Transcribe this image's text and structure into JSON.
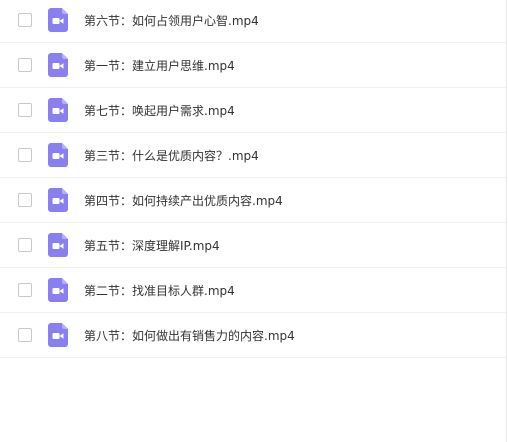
{
  "colors": {
    "icon_bg": "#8a7ff0",
    "icon_fold": "#b6aefa",
    "icon_glyph": "#ffffff",
    "text": "#333333"
  },
  "files": [
    {
      "name": "第六节：如何占领用户心智.mp4",
      "icon": "video-file-icon"
    },
    {
      "name": "第一节：建立用户思维.mp4",
      "icon": "video-file-icon"
    },
    {
      "name": "第七节：唤起用户需求.mp4",
      "icon": "video-file-icon"
    },
    {
      "name": "第三节：什么是优质内容？.mp4",
      "icon": "video-file-icon"
    },
    {
      "name": "第四节：如何持续产出优质内容.mp4",
      "icon": "video-file-icon"
    },
    {
      "name": "第五节：深度理解IP.mp4",
      "icon": "video-file-icon"
    },
    {
      "name": "第二节：找准目标人群.mp4",
      "icon": "video-file-icon"
    },
    {
      "name": "第八节：如何做出有销售力的内容.mp4",
      "icon": "video-file-icon"
    }
  ]
}
